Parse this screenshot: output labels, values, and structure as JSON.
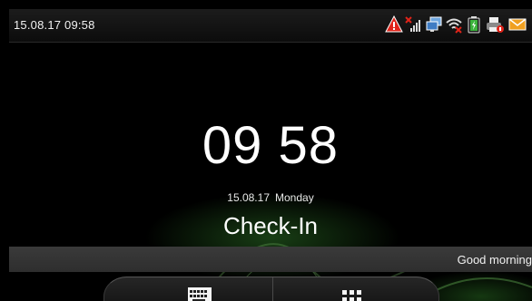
{
  "statusbar": {
    "datetime": "15.08.17 09:58",
    "icons": [
      "warning-icon",
      "no-signal-icon",
      "network-icon",
      "wifi-off-icon",
      "battery-icon",
      "printer-icon",
      "message-icon"
    ]
  },
  "clock": {
    "time": "09 58",
    "date": "15.08.17",
    "weekday": "Monday",
    "mode": "Check-In"
  },
  "ticker": {
    "text": "Good morning"
  },
  "dock": {
    "keyboard_icon": "keyboard-icon",
    "menu_icon": "app-grid-icon"
  },
  "colors": {
    "background": "#000000",
    "statusbar": "#141414",
    "ticker": "#333333",
    "glow": "#46b43c",
    "warning": "#e0241a",
    "battery": "#3cb43c"
  }
}
